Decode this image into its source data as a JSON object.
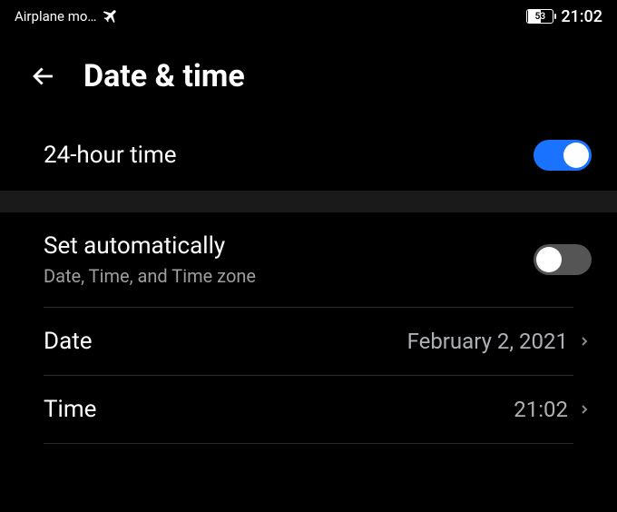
{
  "status": {
    "airplane_label": "Airplane mo…",
    "battery_pct": "53",
    "clock": "21:02"
  },
  "header": {
    "title": "Date & time"
  },
  "settings": {
    "twenty_four_hour": {
      "label": "24-hour time",
      "on": true
    },
    "set_auto": {
      "label": "Set automatically",
      "sublabel": "Date, Time, and Time zone",
      "on": false
    },
    "date": {
      "label": "Date",
      "value": "February 2, 2021"
    },
    "time": {
      "label": "Time",
      "value": "21:02"
    }
  }
}
